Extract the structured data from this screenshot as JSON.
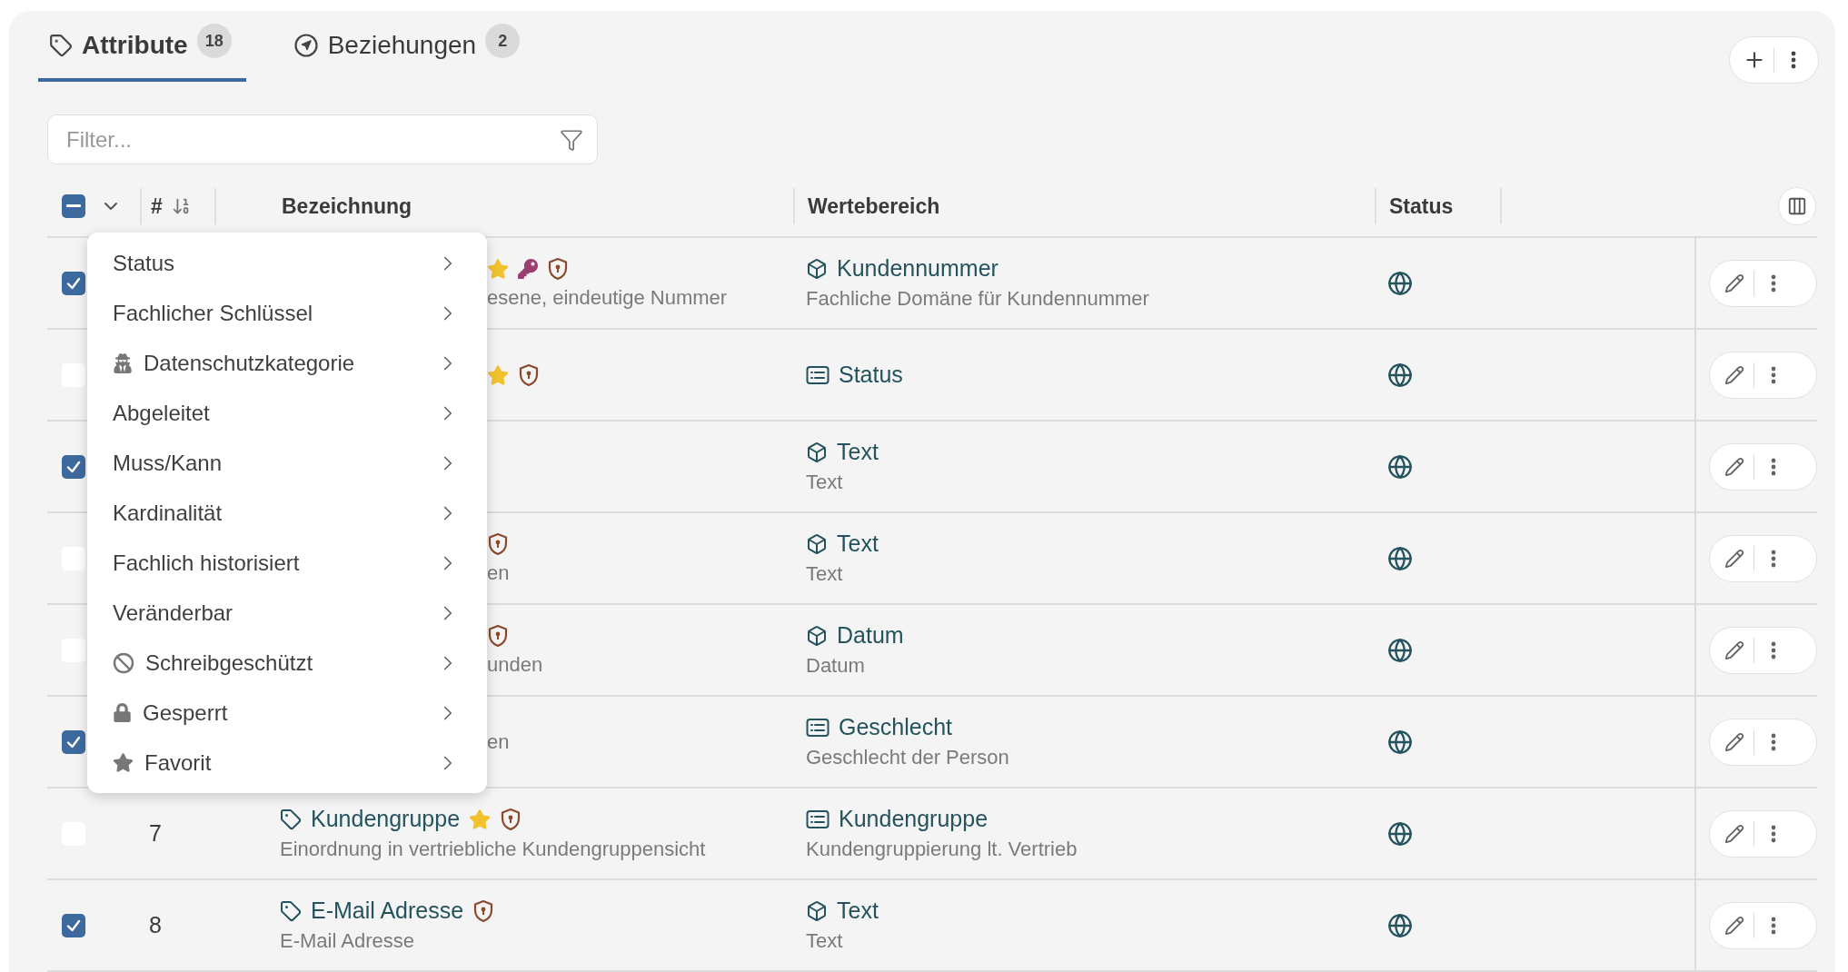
{
  "tabs": [
    {
      "label": "Attribute",
      "count": "18",
      "selected": true
    },
    {
      "label": "Beziehungen",
      "count": "2",
      "selected": false
    }
  ],
  "filter": {
    "placeholder": "Filter..."
  },
  "table": {
    "header_checkbox": {
      "indeterminate": true
    },
    "columns": [
      "#",
      "Bezeichnung",
      "Wertebereich",
      "Status"
    ],
    "rows": [
      {
        "selected": true,
        "covered": true,
        "favorite": true,
        "key": true,
        "protected": true,
        "description": "esene, eindeutige Nummer",
        "domain": {
          "kind": "type",
          "name": "Kundennummer",
          "description": "Fachliche Domäne für Kundennummer"
        }
      },
      {
        "selected": false,
        "covered": true,
        "favorite": true,
        "key": false,
        "protected": true,
        "domain": {
          "kind": "list",
          "name": "Status"
        }
      },
      {
        "selected": true,
        "covered": true,
        "favorite": false,
        "key": false,
        "protected": false,
        "domain": {
          "kind": "type",
          "name": "Text",
          "description": "Text"
        }
      },
      {
        "selected": false,
        "covered": true,
        "favorite": false,
        "key": false,
        "protected": true,
        "description": "en",
        "domain": {
          "kind": "type",
          "name": "Text",
          "description": "Text"
        }
      },
      {
        "selected": false,
        "covered": true,
        "favorite": false,
        "key": false,
        "protected": true,
        "description": "unden",
        "domain": {
          "kind": "type",
          "name": "Datum",
          "description": "Datum"
        }
      },
      {
        "selected": true,
        "covered": true,
        "favorite": false,
        "key": false,
        "protected": false,
        "description": "en",
        "domain": {
          "kind": "list",
          "name": "Geschlecht",
          "description": "Geschlecht der Person"
        }
      },
      {
        "selected": false,
        "covered": false,
        "number": "7",
        "name": "Kundengruppe",
        "favorite": true,
        "key": false,
        "protected": true,
        "description": "Einordnung in vertriebliche Kundengruppensicht",
        "domain": {
          "kind": "list",
          "name": "Kundengruppe",
          "description": "Kundengruppierung lt. Vertrieb"
        }
      },
      {
        "selected": true,
        "covered": false,
        "number": "8",
        "name": "E-Mail Adresse",
        "favorite": false,
        "key": false,
        "protected": true,
        "description": "E-Mail Adresse",
        "domain": {
          "kind": "type",
          "name": "Text",
          "description": "Text"
        }
      }
    ]
  },
  "menu": {
    "items": [
      {
        "kind": "plain",
        "label": "Status"
      },
      {
        "kind": "plain",
        "label": "Fachlicher Schlüssel"
      },
      {
        "kind": "privacy",
        "label": "Datenschutzkategorie"
      },
      {
        "kind": "plain",
        "label": "Abgeleitet"
      },
      {
        "kind": "plain",
        "label": "Muss/Kann"
      },
      {
        "kind": "plain",
        "label": "Kardinalität"
      },
      {
        "kind": "plain",
        "label": "Fachlich historisiert"
      },
      {
        "kind": "plain",
        "label": "Veränderbar"
      },
      {
        "kind": "readonly",
        "label": "Schreibgeschützt"
      },
      {
        "kind": "locked",
        "label": "Gesperrt"
      },
      {
        "kind": "favorite",
        "label": "Favorit"
      }
    ]
  }
}
